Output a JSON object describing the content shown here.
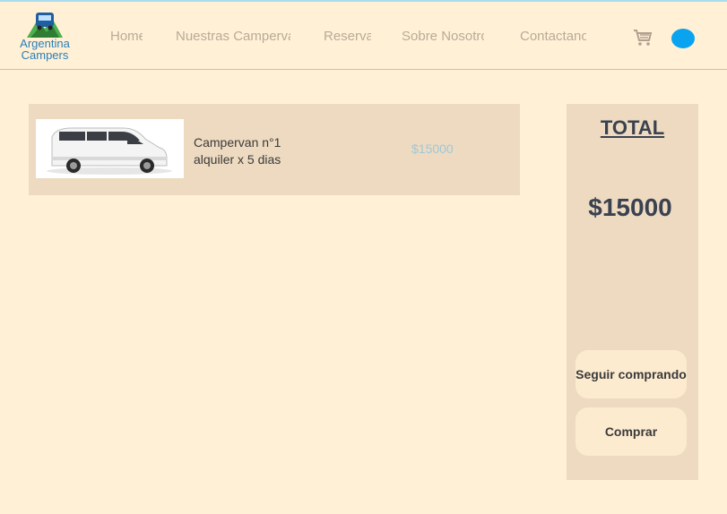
{
  "brand": {
    "line1": "Argentina",
    "line2": "Campers"
  },
  "nav": {
    "items": [
      {
        "label": "Home"
      },
      {
        "label": "Nuestras Campervan"
      },
      {
        "label": "Reserva"
      },
      {
        "label": "Sobre Nosotros"
      },
      {
        "label": "Contactanos"
      }
    ],
    "cart_icon": "shopping-cart-icon",
    "user_icon": "user-avatar-dot"
  },
  "cart": {
    "items": [
      {
        "name": "Campervan n°1 alquiler x 5 dias",
        "price": "$15000",
        "image_icon": "white-van-image"
      }
    ]
  },
  "summary": {
    "title": "TOTAL",
    "amount": "$15000",
    "continue_label": "Seguir comprando",
    "buy_label": "Comprar"
  },
  "colors": {
    "background": "#fff0d6",
    "panel": "#eddac0",
    "button": "#fdebd0",
    "accent_blue": "#0aa3f0",
    "nav_text": "#b8ab98"
  }
}
